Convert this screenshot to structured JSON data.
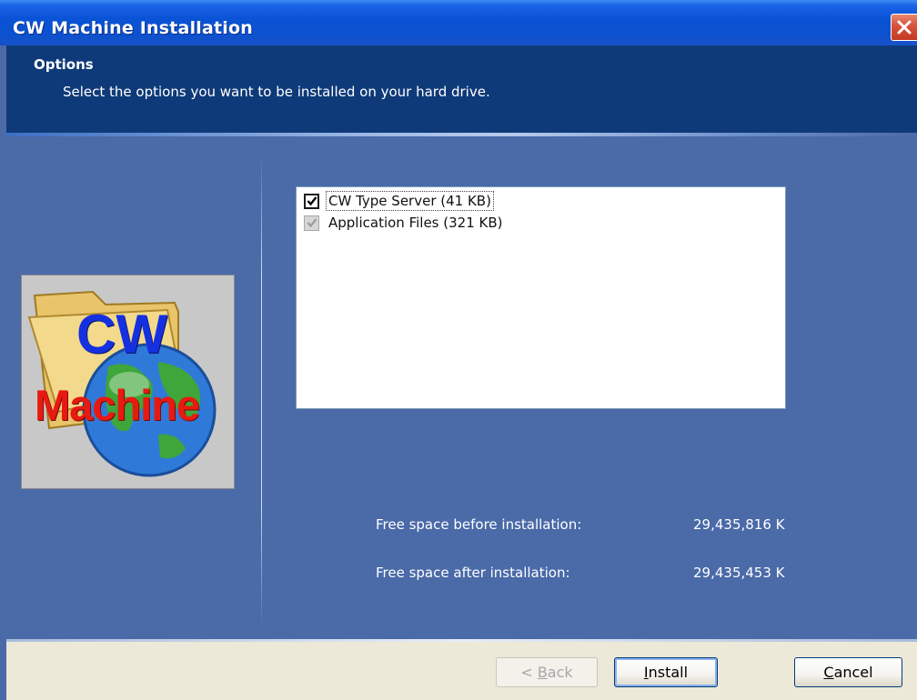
{
  "window": {
    "title": "CW Machine Installation",
    "close_icon": "close-icon"
  },
  "header": {
    "title": "Options",
    "subtitle": "Select the options you want to be installed on your hard drive."
  },
  "logo": {
    "top_text": "CW",
    "bottom_text": "Machine",
    "icon": "folder-globe-icon"
  },
  "options": [
    {
      "label": "CW Type Server (41 KB)",
      "checked": true,
      "enabled": true
    },
    {
      "label": "Application Files (321 KB)",
      "checked": true,
      "enabled": false
    }
  ],
  "space": {
    "before_label": "Free space before installation:",
    "before_value": "29,435,816 K",
    "after_label": "Free space after installation:",
    "after_value": "29,435,453 K"
  },
  "buttons": {
    "back_prefix": "< ",
    "back_mnemonic": "B",
    "back_rest": "ack",
    "install_mnemonic": "I",
    "install_rest": "nstall",
    "cancel_mnemonic": "C",
    "cancel_rest": "ancel"
  },
  "colors": {
    "titlebar": "#0a53d6",
    "header": "#0f3a79",
    "body": "#4a6aa8",
    "footer": "#ece9d8",
    "logo_cw": "#1530e0",
    "logo_machine": "#e81a10"
  }
}
